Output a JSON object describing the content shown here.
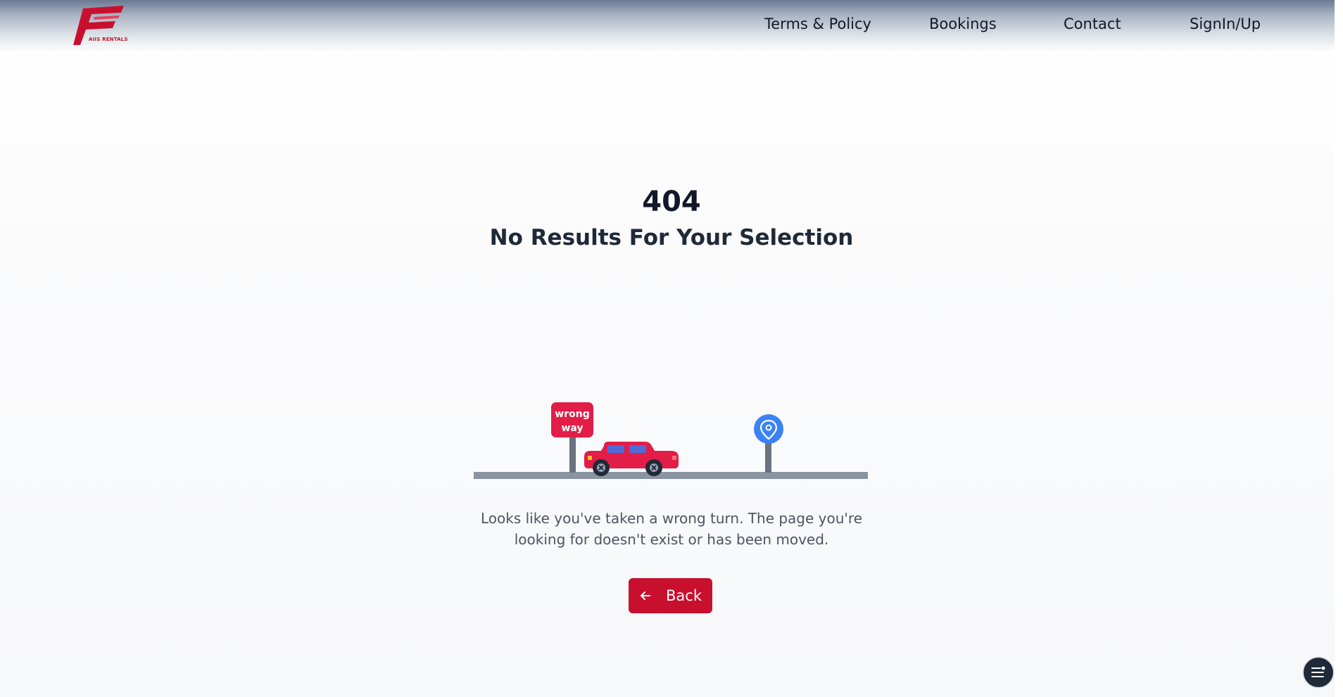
{
  "header": {
    "logo_alt": "F",
    "logo_text": "AIIS RENTALS",
    "nav": {
      "terms": "Terms & Policy",
      "bookings": "Bookings",
      "contact": "Contact",
      "sign": "SignIn/Up"
    }
  },
  "main": {
    "code": "404",
    "subtitle": "No Results For Your Selection",
    "sign_line1": "wrong",
    "sign_line2": "way",
    "message_line1": "Looks like you've taken a wrong turn. The page you're",
    "message_line2": "looking for doesn't exist or has been moved.",
    "back_label": "Back"
  },
  "colors": {
    "brand": "#c8102e",
    "pin": "#3b82f6",
    "road": "#8a93a0"
  },
  "icons": {
    "back": "arrow-left-icon",
    "chat": "chat-menu-icon",
    "pin": "location-pin-icon"
  }
}
